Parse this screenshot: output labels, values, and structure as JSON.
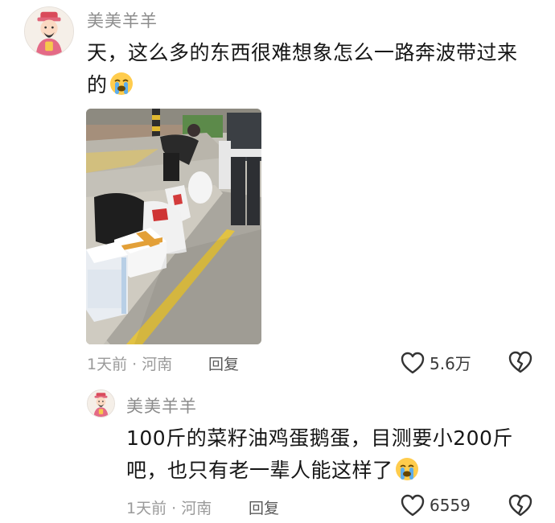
{
  "comment": {
    "username": "美美羊羊",
    "text_line1": "天，这么多的东西很难想象怎么一路奔波带过来",
    "text_line2": "的",
    "emoji": "loudly-crying-face",
    "time": "1天前",
    "separator": "·",
    "location": "河南",
    "reply_label": "回复",
    "like_count": "5.6万"
  },
  "reply": {
    "username": "美美羊羊",
    "text_line1": "100斤的菜籽油鸡蛋鹅蛋，目测要小200斤",
    "text_line2": "吧，也只有老一辈人能这样了",
    "emoji": "loudly-crying-face",
    "time": "1天前",
    "separator": "·",
    "location": "河南",
    "reply_label": "回复",
    "like_count": "6559"
  }
}
